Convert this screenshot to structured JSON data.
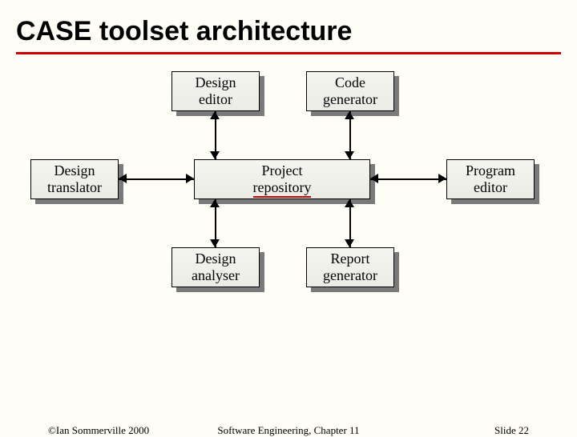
{
  "title": "CASE toolset architecture",
  "nodes": {
    "design_editor": "Design\neditor",
    "code_generator": "Code\ngenerator",
    "design_translator": "Design\ntranslator",
    "project_repository_prefix": "Project",
    "project_repository_underlined": "repository",
    "program_editor": "Program\neditor",
    "design_analyser": "Design\nanalyser",
    "report_generator": "Report\ngenerator"
  },
  "footer": {
    "copyright": "©Ian Sommerville 2000",
    "chapter": "Software Engineering, Chapter 11",
    "slide": "Slide 22"
  }
}
